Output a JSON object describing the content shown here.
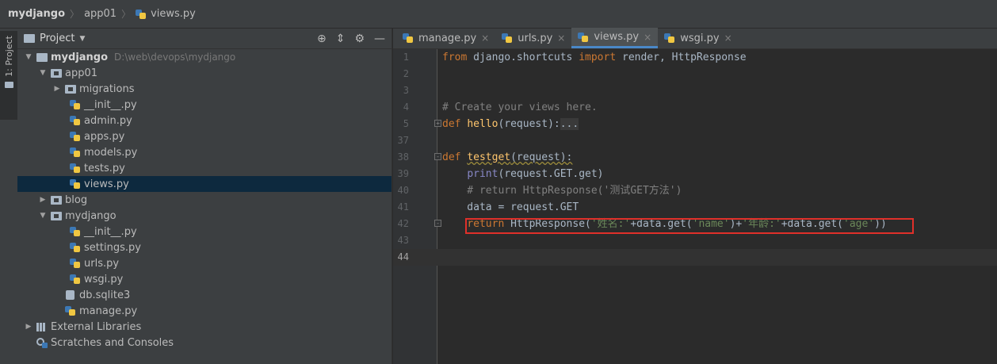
{
  "breadcrumb": [
    "mydjango",
    "app01",
    "views.py"
  ],
  "toolstrip": {
    "project_tab": "1: Project"
  },
  "project_panel": {
    "title": "Project",
    "tree": [
      {
        "label": "mydjango",
        "path": "D:\\web\\devops\\mydjango",
        "depth": 0,
        "expanded": true,
        "type": "folder",
        "bold": true
      },
      {
        "label": "app01",
        "depth": 1,
        "expanded": true,
        "type": "folder"
      },
      {
        "label": "migrations",
        "depth": 2,
        "expanded": false,
        "type": "folder"
      },
      {
        "label": "__init__.py",
        "depth": 3,
        "type": "py"
      },
      {
        "label": "admin.py",
        "depth": 3,
        "type": "py"
      },
      {
        "label": "apps.py",
        "depth": 3,
        "type": "py"
      },
      {
        "label": "models.py",
        "depth": 3,
        "type": "py"
      },
      {
        "label": "tests.py",
        "depth": 3,
        "type": "py"
      },
      {
        "label": "views.py",
        "depth": 3,
        "type": "py",
        "selected": true
      },
      {
        "label": "blog",
        "depth": 1,
        "expanded": false,
        "type": "folder"
      },
      {
        "label": "mydjango",
        "depth": 1,
        "expanded": true,
        "type": "folder"
      },
      {
        "label": "__init__.py",
        "depth": 3,
        "type": "py"
      },
      {
        "label": "settings.py",
        "depth": 3,
        "type": "py"
      },
      {
        "label": "urls.py",
        "depth": 3,
        "type": "py"
      },
      {
        "label": "wsgi.py",
        "depth": 3,
        "type": "py"
      },
      {
        "label": "db.sqlite3",
        "depth": 2,
        "type": "db"
      },
      {
        "label": "manage.py",
        "depth": 2,
        "type": "py"
      },
      {
        "label": "External Libraries",
        "depth": 0,
        "expanded": false,
        "type": "lib"
      },
      {
        "label": "Scratches and Consoles",
        "depth": 0,
        "type": "scratch"
      }
    ]
  },
  "editor": {
    "tabs": [
      {
        "label": "manage.py",
        "active": false
      },
      {
        "label": "urls.py",
        "active": false
      },
      {
        "label": "views.py",
        "active": true
      },
      {
        "label": "wsgi.py",
        "active": false
      }
    ],
    "lines": [
      {
        "num": "1",
        "tokens": [
          [
            "kw",
            "from "
          ],
          [
            "plain",
            "django.shortcuts "
          ],
          [
            "kw",
            "import "
          ],
          [
            "plain",
            "render, HttpResponse"
          ]
        ]
      },
      {
        "num": "2",
        "tokens": []
      },
      {
        "num": "3",
        "tokens": []
      },
      {
        "num": "4",
        "tokens": [
          [
            "cm",
            "# Create your views here."
          ]
        ]
      },
      {
        "num": "5",
        "tokens": [
          [
            "kw",
            "def "
          ],
          [
            "fn",
            "hello"
          ],
          [
            "plain",
            "(request):"
          ],
          [
            "foldbox",
            "..."
          ]
        ],
        "fold": "+"
      },
      {
        "num": "37",
        "tokens": []
      },
      {
        "num": "38",
        "tokens": [
          [
            "kw",
            "def "
          ],
          [
            "fn squig",
            "testget"
          ],
          [
            "plain squig",
            "(request):"
          ]
        ],
        "fold": "-"
      },
      {
        "num": "39",
        "tokens": [
          [
            "plain",
            "    "
          ],
          [
            "builtin",
            "print"
          ],
          [
            "plain",
            "(request.GET.get)"
          ]
        ]
      },
      {
        "num": "40",
        "tokens": [
          [
            "cm",
            "    # return HttpResponse('测试GET方法')"
          ]
        ]
      },
      {
        "num": "41",
        "tokens": [
          [
            "plain",
            "    data = request.GET"
          ]
        ]
      },
      {
        "num": "42",
        "tokens": [
          [
            "plain",
            "    "
          ],
          [
            "kw",
            "return "
          ],
          [
            "plain",
            "HttpResponse("
          ],
          [
            "str",
            "'姓名:'"
          ],
          [
            "plain",
            "+data.get("
          ],
          [
            "str",
            "'name'"
          ],
          [
            "plain",
            ")+"
          ],
          [
            "str",
            "'年龄:'"
          ],
          [
            "plain",
            "+data.get("
          ],
          [
            "str",
            "'age'"
          ],
          [
            "plain",
            "))"
          ]
        ],
        "fold": "-"
      },
      {
        "num": "43",
        "tokens": []
      },
      {
        "num": "44",
        "tokens": [],
        "current": true
      }
    ]
  }
}
